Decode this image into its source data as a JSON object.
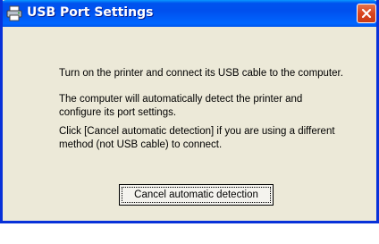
{
  "window": {
    "title": "USB Port Settings",
    "title_icon": "printer-icon",
    "close_icon": "close-icon"
  },
  "message": {
    "line1": "Turn on the printer and connect its USB cable to the computer.",
    "line2": "The computer will automatically detect the printer and configure its port settings.",
    "line3": "Click [Cancel automatic detection] if you are using a different method (not USB cable) to connect."
  },
  "buttons": {
    "cancel_detection": "Cancel automatic detection"
  },
  "colors": {
    "titlebar": "#0050ee",
    "window_bg": "#ece9d8",
    "close_button": "#d9451f"
  }
}
